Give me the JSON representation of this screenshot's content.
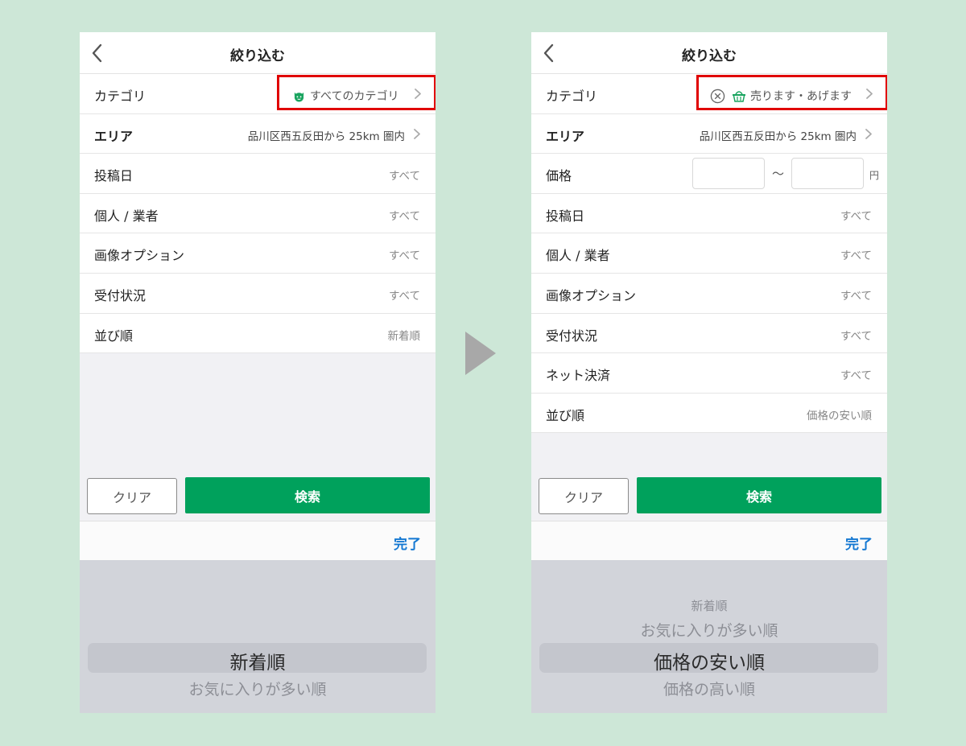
{
  "colors": {
    "background": "#cde7d7",
    "accent_green": "#00a15c",
    "highlight_red": "#e00000",
    "link_blue": "#1478d2"
  },
  "left": {
    "title": "絞り込む",
    "rows": [
      {
        "label": "カテゴリ",
        "value": "すべてのカテゴリ",
        "icon": "cat-face-icon"
      },
      {
        "label": "エリア",
        "value": "品川区西五反田から 25km 圏内"
      },
      {
        "label": "投稿日",
        "value": "すべて"
      },
      {
        "label": "個人 / 業者",
        "value": "すべて"
      },
      {
        "label": "画像オプション",
        "value": "すべて"
      },
      {
        "label": "受付状況",
        "value": "すべて"
      },
      {
        "label": "並び順",
        "value": "新着順"
      }
    ],
    "clear_label": "クリア",
    "search_label": "検索",
    "done_label": "完了",
    "picker": [
      "新着順",
      "お気に入りが多い順"
    ]
  },
  "right": {
    "title": "絞り込む",
    "rows": [
      {
        "label": "カテゴリ",
        "value": "売ります・あげます",
        "icon": "basket-icon"
      },
      {
        "label": "エリア",
        "value": "品川区西五反田から 25km 圏内"
      },
      {
        "label": "価格",
        "tilde": "〜",
        "unit": "円"
      },
      {
        "label": "投稿日",
        "value": "すべて"
      },
      {
        "label": "個人 / 業者",
        "value": "すべて"
      },
      {
        "label": "画像オプション",
        "value": "すべて"
      },
      {
        "label": "受付状況",
        "value": "すべて"
      },
      {
        "label": "ネット決済",
        "value": "すべて"
      },
      {
        "label": "並び順",
        "value": "価格の安い順"
      }
    ],
    "clear_label": "クリア",
    "search_label": "検索",
    "done_label": "完了",
    "picker": [
      "新着順",
      "お気に入りが多い順",
      "価格の安い順",
      "価格の高い順"
    ]
  }
}
